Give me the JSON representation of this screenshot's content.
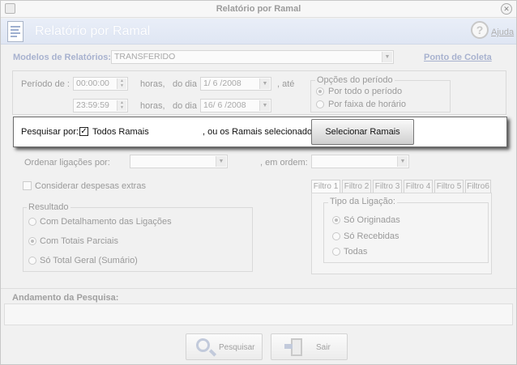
{
  "window": {
    "title": "Relatório por Ramal"
  },
  "header": {
    "title": "Relatório por Ramal",
    "help_label": "Ajuda"
  },
  "models": {
    "label": "Modelos de Relatórios:",
    "selected": "TRANSFERIDO",
    "collection_link": "Ponto de Coleta"
  },
  "period": {
    "label": "Período de :",
    "start_time": "00:00:00",
    "end_time": "23:59:59",
    "hours_label": "horas,",
    "day_label": "do dia",
    "start_date": "1/ 6 /2008",
    "end_date": "16/ 6 /2008",
    "until_label": ", até",
    "options_title": "Opções do período",
    "option_all": "Por todo o período",
    "option_time_band": "Por faixa de horário",
    "selected_option": "option_all"
  },
  "search_by": {
    "label": "Pesquisar por:",
    "all_extensions_label": "Todos Ramais",
    "all_extensions_checked": true,
    "or_selected_label": ", ou os Ramais selecionados:",
    "select_button": "Selecionar Ramais"
  },
  "order": {
    "label": "Ordenar ligações por:",
    "order_label": ", em ordem:",
    "sort_value": "",
    "order_value": ""
  },
  "extra": {
    "label": "Considerar  despesas  extras",
    "checked": false
  },
  "result": {
    "title": "Resultado",
    "options": [
      "Com Detalhamento das Ligações",
      "Com Totais  Parciais",
      "Só Total  Geral (Sumário)"
    ],
    "selected_index": 1
  },
  "filters": {
    "tabs": [
      "Filtro 1",
      "Filtro 2",
      "Filtro 3",
      "Filtro 4",
      "Filtro 5",
      "Filtro6"
    ],
    "active_tab": 0,
    "call_type_title": "Tipo da Ligação:",
    "call_types": [
      "Só Originadas",
      "Só Recebidas",
      "Todas"
    ],
    "selected_call_type": 0
  },
  "progress": {
    "label": "Andamento da Pesquisa:",
    "value": 0
  },
  "actions": {
    "search_button": "Pesquisar",
    "exit_button": "Sair"
  }
}
